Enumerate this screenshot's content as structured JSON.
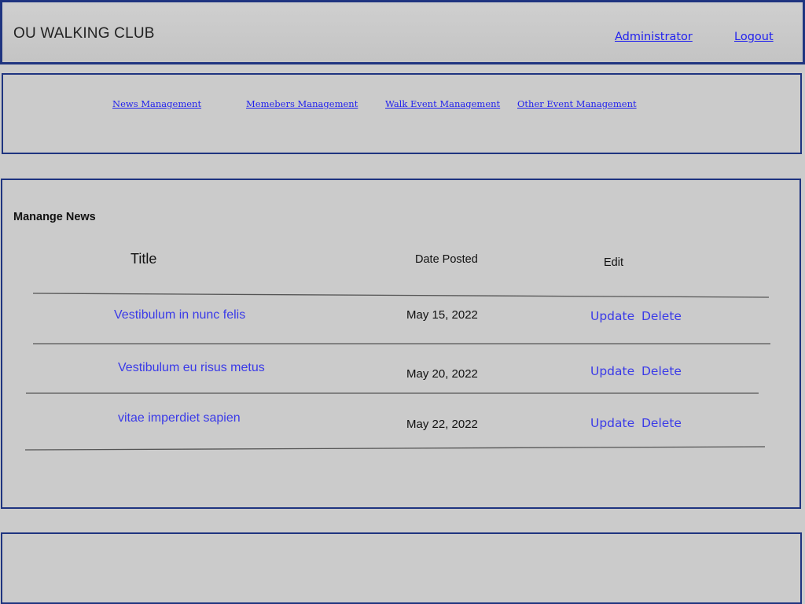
{
  "header": {
    "title": "OU WALKING CLUB",
    "admin_link": "Administrator",
    "logout_link": "Logout"
  },
  "nav": {
    "items": [
      {
        "label": "News Management"
      },
      {
        "label": "Memebers Management"
      },
      {
        "label": "Walk Event Management"
      },
      {
        "label": "Other Event Management"
      }
    ]
  },
  "main": {
    "section_title": "Manange News",
    "columns": {
      "title": "Title",
      "date": "Date Posted",
      "edit": "Edit"
    },
    "rows": [
      {
        "title": "Vestibulum in nunc felis",
        "date": "May 15, 2022",
        "update": "Update",
        "delete": "Delete"
      },
      {
        "title": "Vestibulum eu risus metus",
        "date": "May 20, 2022",
        "update": "Update",
        "delete": "Delete"
      },
      {
        "title": "vitae imperdiet sapien",
        "date": "May 22, 2022",
        "update": "Update",
        "delete": "Delete"
      }
    ]
  },
  "colors": {
    "border": "#1f3480",
    "background": "#cbcbcb",
    "link": "#2222ee",
    "row_link": "#3a3ae8"
  }
}
